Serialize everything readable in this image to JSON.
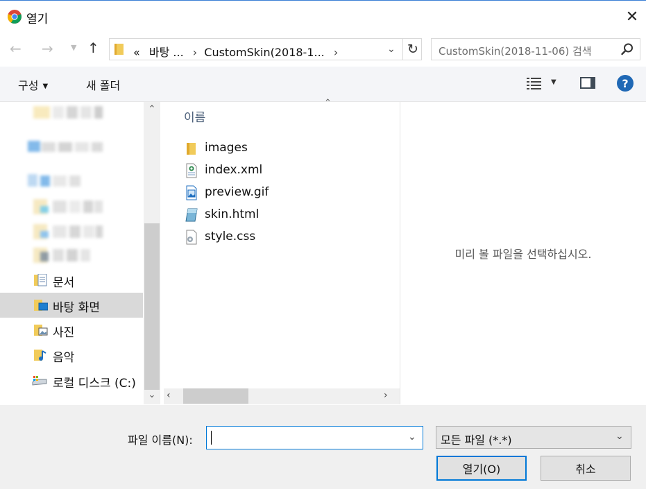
{
  "window": {
    "title": "열기",
    "app_icon": "chrome-icon",
    "close_glyph": "✕"
  },
  "navigation": {
    "back_glyph": "←",
    "forward_glyph": "→",
    "recent_glyph": "⌄",
    "up_glyph": "↑"
  },
  "address": {
    "overflow": "«",
    "crumbs": [
      "바탕 ...",
      "CustomSkin(2018-1..."
    ],
    "separator": "›",
    "dropdown_glyph": "⌄",
    "refresh_glyph": "↻"
  },
  "search": {
    "placeholder": "CustomSkin(2018-11-06) 검색",
    "icon": "search-icon"
  },
  "toolbar": {
    "organize_label": "구성",
    "new_folder_label": "새 폴더",
    "view_icon": "details-view-icon",
    "preview_pane_icon": "preview-pane-icon",
    "help_label": "?"
  },
  "nav_pane": {
    "items": [
      {
        "label": "문서",
        "icon": "documents-icon",
        "selected": false
      },
      {
        "label": "바탕 화면",
        "icon": "desktop-icon",
        "selected": true
      },
      {
        "label": "사진",
        "icon": "pictures-icon",
        "selected": false
      },
      {
        "label": "음악",
        "icon": "music-icon",
        "selected": false
      },
      {
        "label": "로컬 디스크 (C:)",
        "icon": "drive-icon",
        "selected": false
      }
    ]
  },
  "file_list": {
    "column_name": "이름",
    "files": [
      {
        "name": "images",
        "icon": "folder-icon"
      },
      {
        "name": "index.xml",
        "icon": "xml-file-icon"
      },
      {
        "name": "preview.gif",
        "icon": "image-file-icon"
      },
      {
        "name": "skin.html",
        "icon": "html-file-icon"
      },
      {
        "name": "style.css",
        "icon": "css-file-icon"
      }
    ]
  },
  "preview": {
    "message": "미리 볼 파일을 선택하십시오."
  },
  "footer": {
    "filename_label": "파일 이름(N):",
    "filename_value": "",
    "filetype_value": "모든 파일 (*.*)",
    "open_label": "열기(O)",
    "cancel_label": "취소"
  },
  "colors": {
    "accent": "#0078d7",
    "folder": "#f1cb5a",
    "selected_nav": "#d9d9d9"
  }
}
